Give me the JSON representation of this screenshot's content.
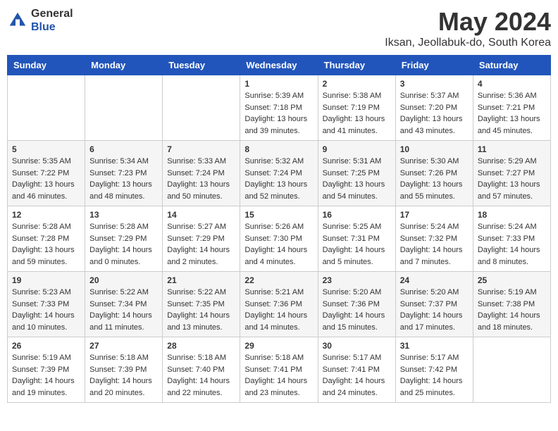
{
  "logo": {
    "general": "General",
    "blue": "Blue"
  },
  "title": "May 2024",
  "location": "Iksan, Jeollabuk-do, South Korea",
  "headers": [
    "Sunday",
    "Monday",
    "Tuesday",
    "Wednesday",
    "Thursday",
    "Friday",
    "Saturday"
  ],
  "weeks": [
    [
      {
        "day": "",
        "info": ""
      },
      {
        "day": "",
        "info": ""
      },
      {
        "day": "",
        "info": ""
      },
      {
        "day": "1",
        "info": "Sunrise: 5:39 AM\nSunset: 7:18 PM\nDaylight: 13 hours\nand 39 minutes."
      },
      {
        "day": "2",
        "info": "Sunrise: 5:38 AM\nSunset: 7:19 PM\nDaylight: 13 hours\nand 41 minutes."
      },
      {
        "day": "3",
        "info": "Sunrise: 5:37 AM\nSunset: 7:20 PM\nDaylight: 13 hours\nand 43 minutes."
      },
      {
        "day": "4",
        "info": "Sunrise: 5:36 AM\nSunset: 7:21 PM\nDaylight: 13 hours\nand 45 minutes."
      }
    ],
    [
      {
        "day": "5",
        "info": "Sunrise: 5:35 AM\nSunset: 7:22 PM\nDaylight: 13 hours\nand 46 minutes."
      },
      {
        "day": "6",
        "info": "Sunrise: 5:34 AM\nSunset: 7:23 PM\nDaylight: 13 hours\nand 48 minutes."
      },
      {
        "day": "7",
        "info": "Sunrise: 5:33 AM\nSunset: 7:24 PM\nDaylight: 13 hours\nand 50 minutes."
      },
      {
        "day": "8",
        "info": "Sunrise: 5:32 AM\nSunset: 7:24 PM\nDaylight: 13 hours\nand 52 minutes."
      },
      {
        "day": "9",
        "info": "Sunrise: 5:31 AM\nSunset: 7:25 PM\nDaylight: 13 hours\nand 54 minutes."
      },
      {
        "day": "10",
        "info": "Sunrise: 5:30 AM\nSunset: 7:26 PM\nDaylight: 13 hours\nand 55 minutes."
      },
      {
        "day": "11",
        "info": "Sunrise: 5:29 AM\nSunset: 7:27 PM\nDaylight: 13 hours\nand 57 minutes."
      }
    ],
    [
      {
        "day": "12",
        "info": "Sunrise: 5:28 AM\nSunset: 7:28 PM\nDaylight: 13 hours\nand 59 minutes."
      },
      {
        "day": "13",
        "info": "Sunrise: 5:28 AM\nSunset: 7:29 PM\nDaylight: 14 hours\nand 0 minutes."
      },
      {
        "day": "14",
        "info": "Sunrise: 5:27 AM\nSunset: 7:29 PM\nDaylight: 14 hours\nand 2 minutes."
      },
      {
        "day": "15",
        "info": "Sunrise: 5:26 AM\nSunset: 7:30 PM\nDaylight: 14 hours\nand 4 minutes."
      },
      {
        "day": "16",
        "info": "Sunrise: 5:25 AM\nSunset: 7:31 PM\nDaylight: 14 hours\nand 5 minutes."
      },
      {
        "day": "17",
        "info": "Sunrise: 5:24 AM\nSunset: 7:32 PM\nDaylight: 14 hours\nand 7 minutes."
      },
      {
        "day": "18",
        "info": "Sunrise: 5:24 AM\nSunset: 7:33 PM\nDaylight: 14 hours\nand 8 minutes."
      }
    ],
    [
      {
        "day": "19",
        "info": "Sunrise: 5:23 AM\nSunset: 7:33 PM\nDaylight: 14 hours\nand 10 minutes."
      },
      {
        "day": "20",
        "info": "Sunrise: 5:22 AM\nSunset: 7:34 PM\nDaylight: 14 hours\nand 11 minutes."
      },
      {
        "day": "21",
        "info": "Sunrise: 5:22 AM\nSunset: 7:35 PM\nDaylight: 14 hours\nand 13 minutes."
      },
      {
        "day": "22",
        "info": "Sunrise: 5:21 AM\nSunset: 7:36 PM\nDaylight: 14 hours\nand 14 minutes."
      },
      {
        "day": "23",
        "info": "Sunrise: 5:20 AM\nSunset: 7:36 PM\nDaylight: 14 hours\nand 15 minutes."
      },
      {
        "day": "24",
        "info": "Sunrise: 5:20 AM\nSunset: 7:37 PM\nDaylight: 14 hours\nand 17 minutes."
      },
      {
        "day": "25",
        "info": "Sunrise: 5:19 AM\nSunset: 7:38 PM\nDaylight: 14 hours\nand 18 minutes."
      }
    ],
    [
      {
        "day": "26",
        "info": "Sunrise: 5:19 AM\nSunset: 7:39 PM\nDaylight: 14 hours\nand 19 minutes."
      },
      {
        "day": "27",
        "info": "Sunrise: 5:18 AM\nSunset: 7:39 PM\nDaylight: 14 hours\nand 20 minutes."
      },
      {
        "day": "28",
        "info": "Sunrise: 5:18 AM\nSunset: 7:40 PM\nDaylight: 14 hours\nand 22 minutes."
      },
      {
        "day": "29",
        "info": "Sunrise: 5:18 AM\nSunset: 7:41 PM\nDaylight: 14 hours\nand 23 minutes."
      },
      {
        "day": "30",
        "info": "Sunrise: 5:17 AM\nSunset: 7:41 PM\nDaylight: 14 hours\nand 24 minutes."
      },
      {
        "day": "31",
        "info": "Sunrise: 5:17 AM\nSunset: 7:42 PM\nDaylight: 14 hours\nand 25 minutes."
      },
      {
        "day": "",
        "info": ""
      }
    ]
  ]
}
